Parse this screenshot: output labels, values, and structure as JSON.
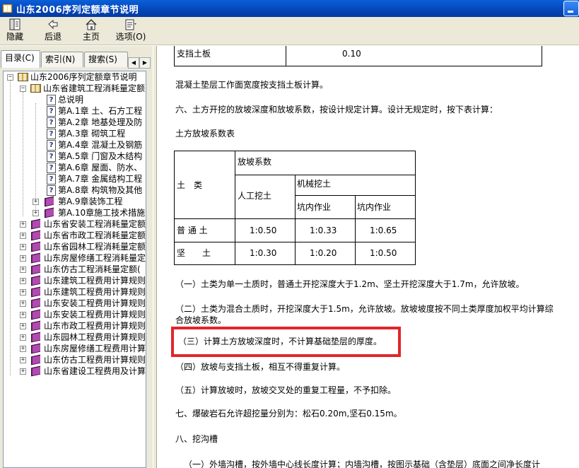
{
  "window": {
    "title": "山东2006序列定额章节说明"
  },
  "toolbar": {
    "hide": "隐藏",
    "back": "后退",
    "home": "主页",
    "options": "选项(O)"
  },
  "tabs": {
    "contents": "目录(C)",
    "index": "索引(N)",
    "search": "搜索(S)"
  },
  "tree": {
    "root": "山东2006序列定额章节说明",
    "node1": "山东省建筑工程消耗量定额",
    "topics": [
      "总说明",
      "第A.1章 土、石方工程",
      "第A.2章 地基处理及防",
      "第A.3章 砌筑工程",
      "第A.4章 混凝土及钢筋",
      "第A.5章 门窗及木结构",
      "第A.6章 屋面、防水、",
      "第A.7章 金属结构工程",
      "第A.8章 构筑物及其他"
    ],
    "subbooks": [
      "第A.9章装饰工程",
      "第A.10章施工技术措施"
    ],
    "books": [
      "山东省安装工程消耗量定额",
      "山东省市政工程消耗量定额",
      "山东省园林工程消耗量定额",
      "山东房屋修缮工程消耗量定",
      "山东仿古工程消耗量定额(",
      "山东建筑工程费用计算规则",
      "山东建筑工程费用计算规则",
      "山东安装工程费用计算规则",
      "山东安装工程费用计算规则",
      "山东市政工程费用计算规则",
      "山东园林工程费用计算规则",
      "山东房屋修缮工程费用计算",
      "山东仿古工程费用计算规则",
      "山东省建设工程费用及计算"
    ]
  },
  "content": {
    "top_table": {
      "label": "支挡土板",
      "value": "0.10"
    },
    "p1": "混凝土垫层工作面宽度按支挡土板计算。",
    "p2": "六、土方开挖的放坡深度和放坡系数，按设计规定计算。设计无规定时，按下表计算：",
    "table_title": "土方放坡系数表",
    "slope_table": {
      "soil_type": "土　类",
      "coef": "放坡系数",
      "manual": "人工挖土",
      "mech": "机械挖土",
      "pit_in": "坑内作业",
      "pit_out": "坑内作业",
      "rows": [
        {
          "name": "普 通 土",
          "manual": "1:0.50",
          "in": "1:0.33",
          "out": "1:0.65"
        },
        {
          "name": "坚　　土",
          "manual": "1:0.30",
          "in": "1:0.20",
          "out": "1:0.50"
        }
      ]
    },
    "n1": "（一）土类为单一土质时，普通土开挖深度大于1.2m、坚土开挖深度大于1.7m，允许放坡。",
    "n2a": "（二）土类为混合土质时，开挖深度大于1.5m，允许放坡。放坡坡度按不同土类厚度加权平均计算综",
    "n2b": "合放坡系数。",
    "n3": "（三）计算土方放坡深度时，不计算基础垫层的厚度。",
    "n4": "（四）放坡与支挡土板，相互不得重复计算。",
    "n5": "（五）计算放坡时，放坡交叉处的重复工程量，不予扣除。",
    "p7": "七、爆破岩石允许超挖量分别为：松石0.20m,坚石0.15m。",
    "p8": "八、挖沟槽",
    "p8a": "（一）外墙沟槽，按外墙中心线长度计算；内墙沟槽，按图示基础（含垫层）底面之间净长度计"
  }
}
